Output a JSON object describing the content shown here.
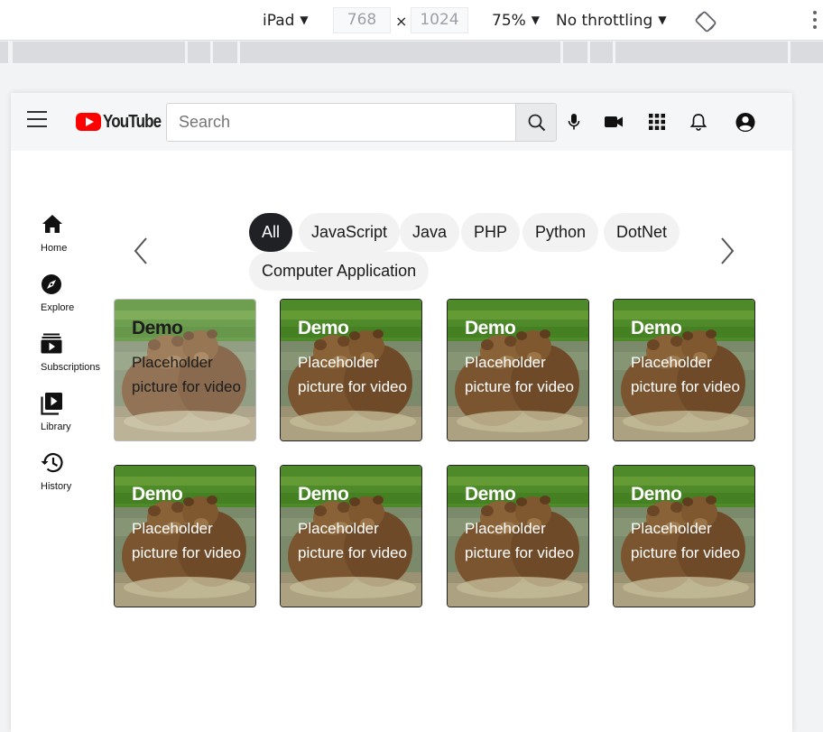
{
  "devtools": {
    "device": "iPad",
    "width": "768",
    "height": "1024",
    "times": "×",
    "zoom": "75%",
    "throttling": "No throttling"
  },
  "header": {
    "brand": "YouTube",
    "search_placeholder": "Search"
  },
  "sidebar": {
    "items": [
      {
        "label": "Home",
        "icon": "home-icon"
      },
      {
        "label": "Explore",
        "icon": "compass-icon"
      },
      {
        "label": "Subscriptions",
        "icon": "subscriptions-icon"
      },
      {
        "label": "Library",
        "icon": "library-icon"
      },
      {
        "label": "History",
        "icon": "history-icon"
      }
    ]
  },
  "chips": [
    "All",
    "JavaScript",
    "Java",
    "PHP",
    "Python",
    "DotNet",
    "Computer Application"
  ],
  "cards": [
    {
      "title": "Demo",
      "desc": "Placeholder picture for video"
    },
    {
      "title": "Demo",
      "desc": "Placeholder picture for video"
    },
    {
      "title": "Demo",
      "desc": "Placeholder picture for video"
    },
    {
      "title": "Demo",
      "desc": "Placeholder picture for video"
    },
    {
      "title": "Demo",
      "desc": "Placeholder picture for video"
    },
    {
      "title": "Demo",
      "desc": "Placeholder picture for video"
    },
    {
      "title": "Demo",
      "desc": "Placeholder picture for video"
    },
    {
      "title": "Demo",
      "desc": "Placeholder picture for video"
    }
  ],
  "colors": {
    "brand_red": "#ff0000",
    "chip_active": "#1f2125",
    "chip_bg": "#f2f2f2"
  }
}
